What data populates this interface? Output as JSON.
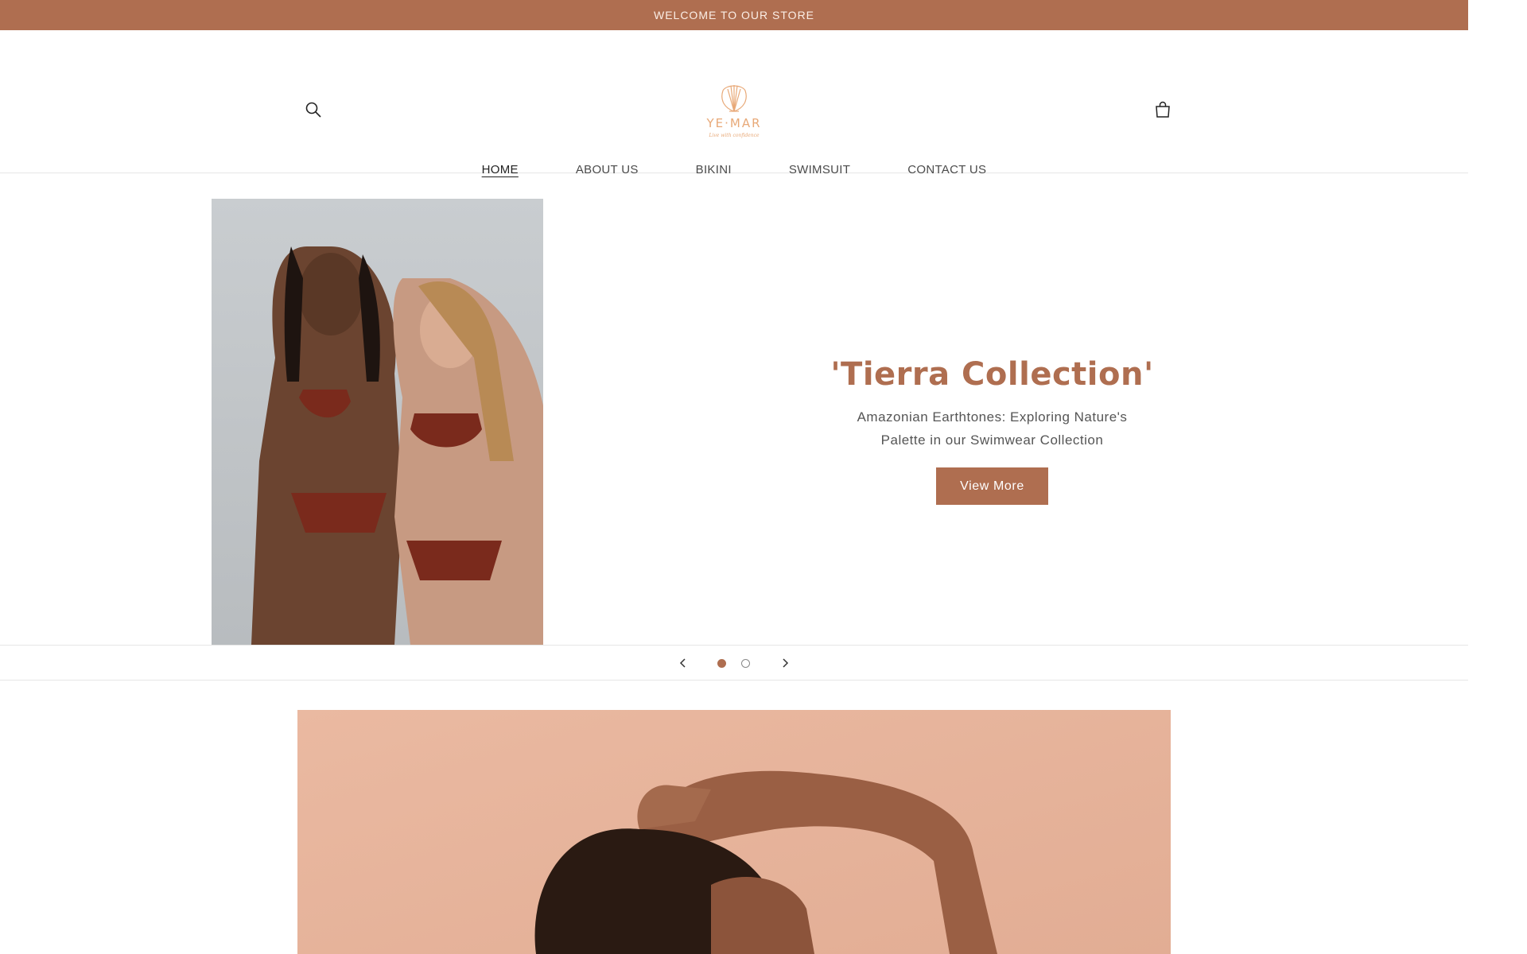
{
  "announcement": {
    "text": "WELCOME TO OUR STORE"
  },
  "header": {
    "logo_text": "YE·MAR",
    "logo_tagline": "Live with confidence",
    "search_icon": "search-icon",
    "cart_icon": "shopping-bag-icon"
  },
  "nav": {
    "items": [
      {
        "label": "HOME",
        "active": true
      },
      {
        "label": "ABOUT US",
        "active": false
      },
      {
        "label": "BIKINI",
        "active": false
      },
      {
        "label": "SWIMSUIT",
        "active": false
      },
      {
        "label": "CONTACT US",
        "active": false
      }
    ]
  },
  "hero": {
    "title": "'Tierra Collection'",
    "text_line1": "Amazonian Earthtones: Exploring Nature's",
    "text_line2": "Palette in our Swimwear Collection",
    "button_label": "View More",
    "image_alt": "Two models in rust-colored bikinis"
  },
  "slider": {
    "slide_count": 2,
    "active_index": 1,
    "prev_icon": "chevron-left-icon",
    "next_icon": "chevron-right-icon"
  },
  "feature": {
    "image_alt": "Model with curly hair on peach background"
  },
  "colors": {
    "accent": "#af6e50",
    "announcement_text": "#fbeee6",
    "logo": "#e8a978"
  }
}
